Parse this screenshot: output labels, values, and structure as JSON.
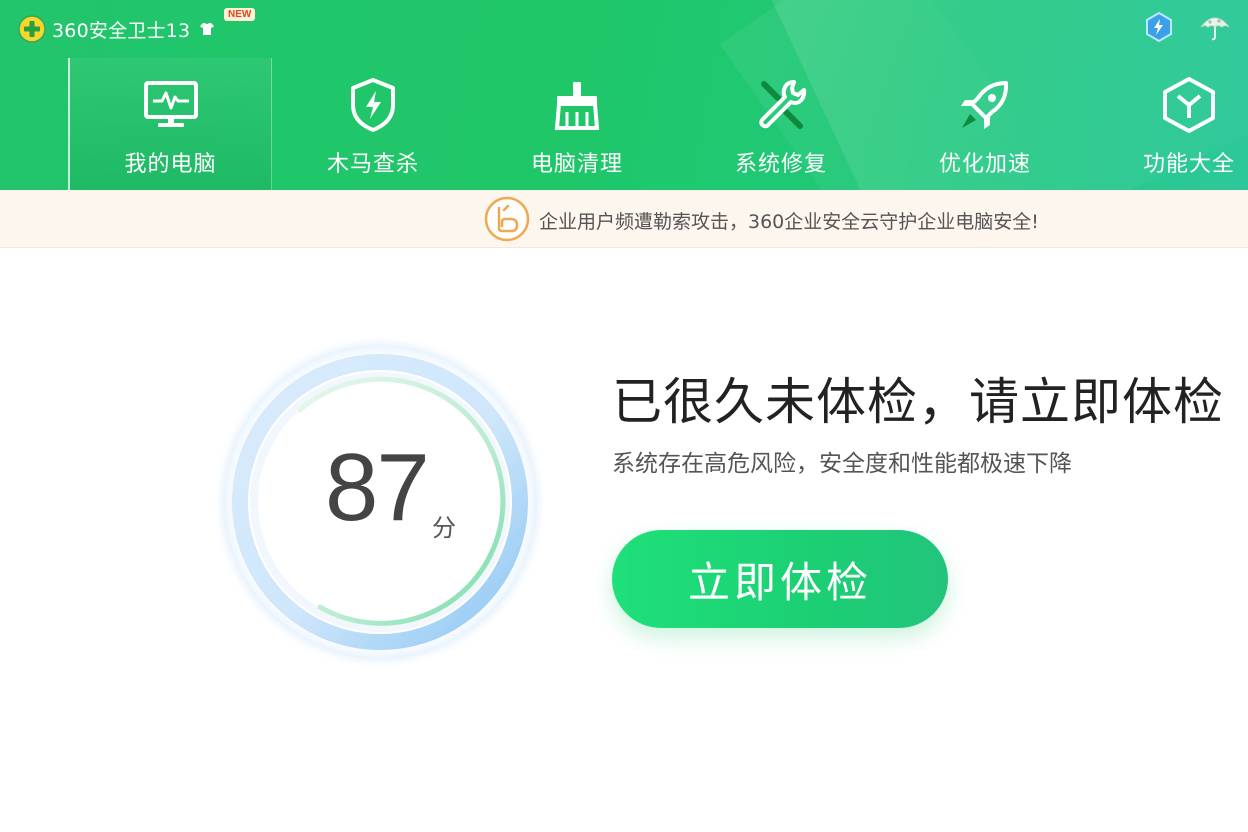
{
  "app": {
    "title": "360安全卫士13",
    "new_badge": "NEW"
  },
  "nav": {
    "items": [
      {
        "label": "我的电脑",
        "icon": "monitor-icon",
        "active": true
      },
      {
        "label": "木马查杀",
        "icon": "shield-bolt-icon",
        "active": false
      },
      {
        "label": "电脑清理",
        "icon": "broom-icon",
        "active": false
      },
      {
        "label": "系统修复",
        "icon": "wrench-icon",
        "active": false
      },
      {
        "label": "优化加速",
        "icon": "rocket-icon",
        "active": false
      },
      {
        "label": "功能大全",
        "icon": "hexagon-y-icon",
        "active": false
      }
    ]
  },
  "notice": {
    "text": "企业用户频遭勒索攻击，360企业安全云守护企业电脑安全!",
    "icon": "enterprise-logo-icon"
  },
  "score": {
    "value": "87",
    "unit": "分"
  },
  "main": {
    "headline": "已很久未体检，请立即体检",
    "subline": "系统存在高危风险，安全度和性能都极速下降",
    "button_label": "立即体检"
  },
  "colors": {
    "brand_green": "#1fc768",
    "button_green": "#1ccf74",
    "notice_bg": "#fdf6ef",
    "notice_icon": "#f0a850"
  }
}
